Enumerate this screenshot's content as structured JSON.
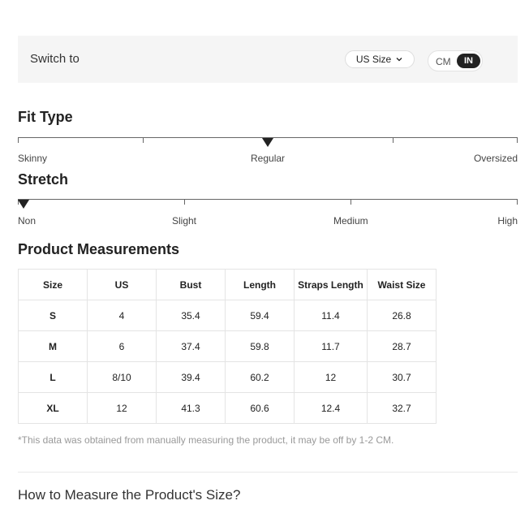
{
  "switch_bar": {
    "label": "Switch to",
    "size_select": "US Size",
    "units": {
      "cm": "CM",
      "in": "IN",
      "selected": "IN"
    }
  },
  "fit_type": {
    "title": "Fit Type",
    "labels": [
      "Skinny",
      "Regular",
      "Oversized"
    ],
    "selected": "Regular"
  },
  "stretch": {
    "title": "Stretch",
    "labels": [
      "Non",
      "Slight",
      "Medium",
      "High"
    ],
    "selected": "Non"
  },
  "measurements": {
    "title": "Product Measurements",
    "headers": [
      "Size",
      "US",
      "Bust",
      "Length",
      "Straps Length",
      "Waist Size"
    ],
    "rows": [
      [
        "S",
        "4",
        "35.4",
        "59.4",
        "11.4",
        "26.8"
      ],
      [
        "M",
        "6",
        "37.4",
        "59.8",
        "11.7",
        "28.7"
      ],
      [
        "L",
        "8/10",
        "39.4",
        "60.2",
        "12",
        "30.7"
      ],
      [
        "XL",
        "12",
        "41.3",
        "60.6",
        "12.4",
        "32.7"
      ]
    ],
    "note": "*This data was obtained from manually measuring the product, it may be off by 1-2 CM."
  },
  "how_to_measure": "How to Measure the Product's Size?"
}
